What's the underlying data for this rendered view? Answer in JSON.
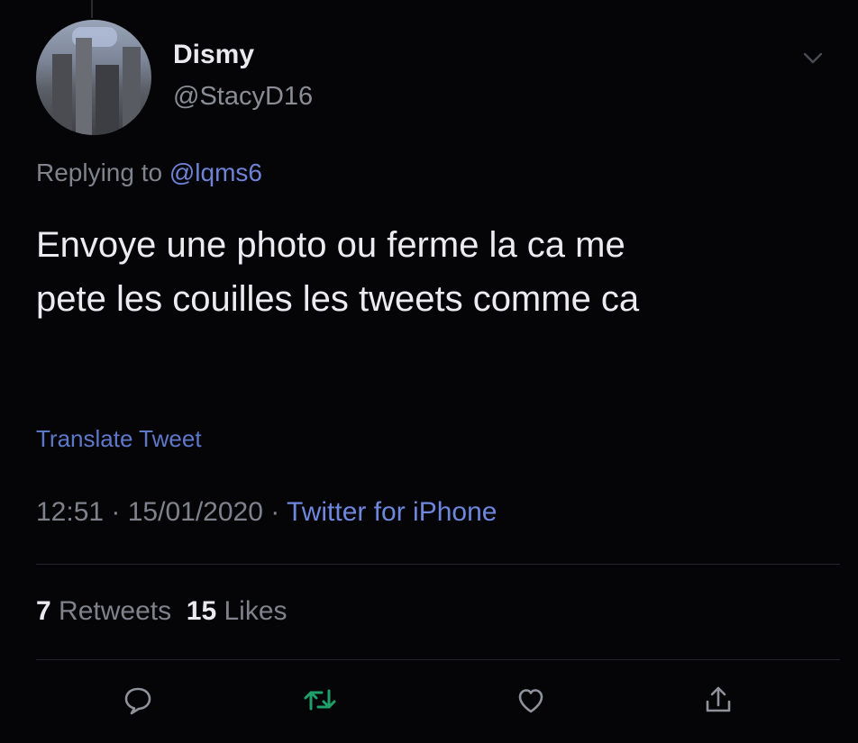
{
  "author": {
    "display_name": "Dismy",
    "handle": "@StacyD16"
  },
  "reply": {
    "prefix": "Replying to ",
    "mention": "@lqms6"
  },
  "tweet": {
    "text_line1": "Envoye une photo ou ferme la ca me",
    "text_line2": "pete les couilles les tweets comme ca",
    "translate_label": "Translate Tweet",
    "time": "12:51",
    "sep1": " · ",
    "date": "15/01/2020",
    "sep2": " · ",
    "source": "Twitter for iPhone"
  },
  "stats": {
    "retweets_count": "7",
    "retweets_label": "Retweets",
    "likes_count": "15",
    "likes_label": "Likes"
  },
  "icons": {
    "menu": "chevron-down-icon",
    "reply": "reply-icon",
    "retweet": "retweet-icon",
    "like": "heart-icon",
    "share": "share-icon"
  },
  "colors": {
    "background": "#050507",
    "link": "#6f83d6",
    "retweet_green": "#1ea06a",
    "muted": "#7f828b"
  }
}
